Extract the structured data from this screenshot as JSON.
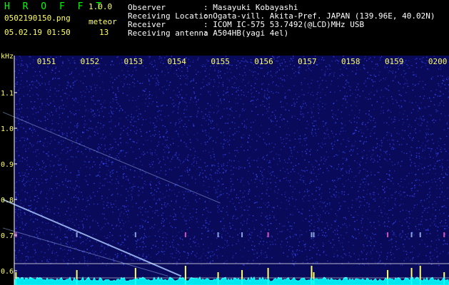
{
  "header": {
    "app_name": "H R O F F T",
    "version": "1.0.0",
    "file_name": "0502190150.png",
    "datetime": "05.02.19 01:50",
    "meteor_label": "meteor",
    "meteor_count": "13"
  },
  "info": [
    {
      "label": "Observer",
      "value": ": Masayuki Kobayashi"
    },
    {
      "label": "Receiving Location",
      "value": ": Ogata-vill. Akita-Pref. JAPAN (139.96E, 40.02N)"
    },
    {
      "label": "Receiver",
      "value": ": ICOM IC-575 53.7492(@LCD)MHz USB"
    },
    {
      "label": "Receiving antenna",
      "value": ": A504HB(yagi 4el)"
    }
  ],
  "colors": {
    "background": "#000000",
    "spectrogram_bg": "#0a0a5a",
    "noise": "#3a4cff",
    "trace": "#aac8ff",
    "echo": "#ffff66",
    "strip": "#00ffff",
    "green_text": "#00ff00",
    "yellow_text": "#ffff66"
  },
  "chart_data": {
    "type": "heatmap",
    "xlabel": "",
    "ylabel": "kHz",
    "x_ticks": [
      "0151",
      "0152",
      "0153",
      "0154",
      "0155",
      "0156",
      "0157",
      "0158",
      "0159",
      "0200"
    ],
    "y_ticks": [
      "1.1",
      "1.0",
      "0.9",
      "0.8",
      "0.7",
      "0.6"
    ],
    "ylim": [
      0.575,
      1.2
    ],
    "traces": [
      {
        "kind": "faint-line",
        "from": {
          "minute": 50.0,
          "khz": 1.045
        },
        "to": {
          "minute": 55.0,
          "khz": 0.79
        }
      },
      {
        "kind": "bright-line",
        "from": {
          "minute": 50.0,
          "khz": 0.8
        },
        "to": {
          "minute": 54.1,
          "khz": 0.585
        }
      },
      {
        "kind": "faint-line",
        "from": {
          "minute": 50.0,
          "khz": 0.72
        },
        "to": {
          "minute": 53.8,
          "khz": 0.585
        }
      }
    ],
    "meteor_echoes": [
      50.3,
      51.7,
      53.05,
      54.2,
      54.95,
      55.5,
      56.1,
      57.1,
      57.15,
      58.85,
      59.4,
      59.6,
      60.15
    ],
    "grid": false
  }
}
